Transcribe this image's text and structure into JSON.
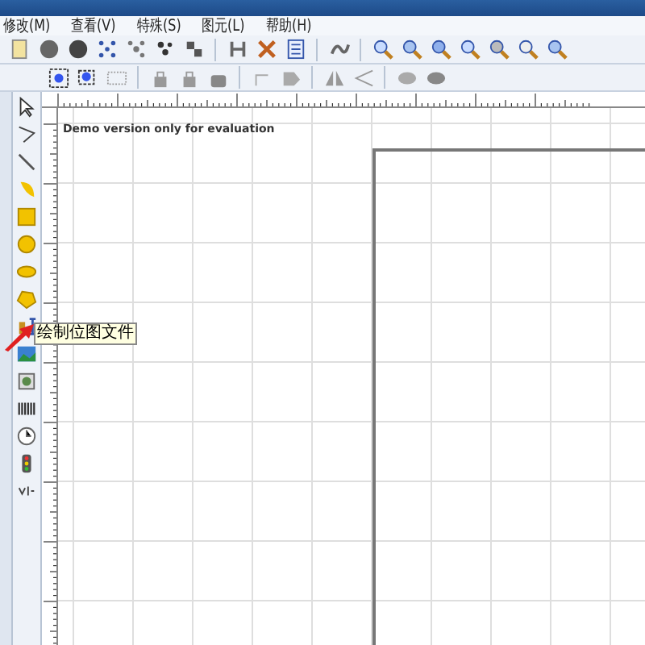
{
  "menu": [
    {
      "label": "修改(M)"
    },
    {
      "label": "查看(V)"
    },
    {
      "label": "特殊(S)"
    },
    {
      "label": "图元(L)"
    },
    {
      "label": "帮助(H)"
    }
  ],
  "tooltip": {
    "text": "绘制位图文件"
  },
  "canvas": {
    "notice": "Demo version only for evaluation"
  }
}
